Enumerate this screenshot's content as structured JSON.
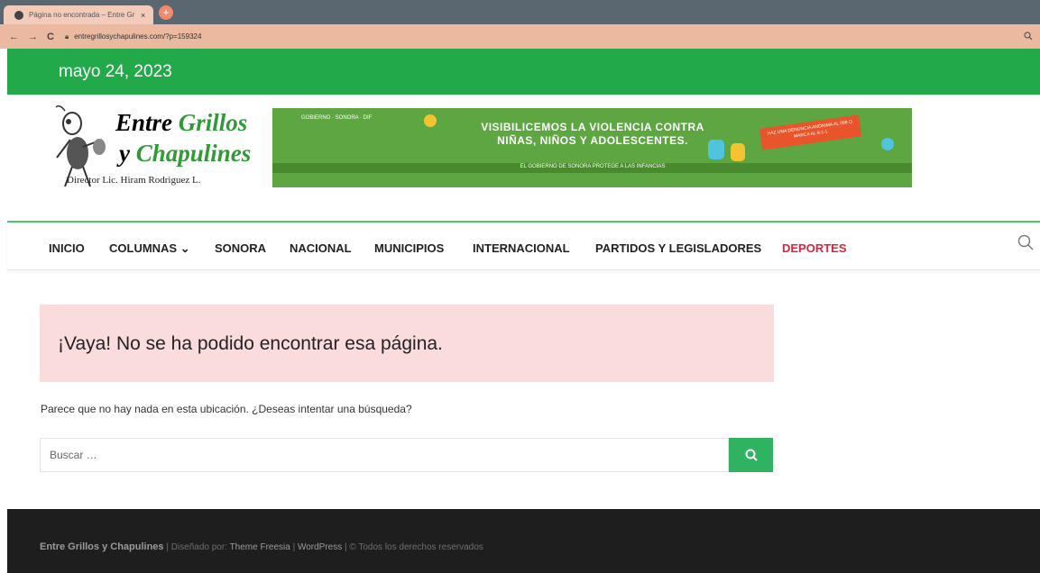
{
  "browser": {
    "tab_title": "Página no encontrada – Entre Gr",
    "tab_close": "×",
    "new_tab": "+",
    "back": "←",
    "forward": "→",
    "reload": "C",
    "url": "entregrillosychapulines.com/?p=159324"
  },
  "site": {
    "date": "mayo 24, 2023",
    "logo": {
      "line1_a": "Entre",
      "line1_b": "Grillos",
      "line2_a": "y",
      "line2_b": "Chapulines",
      "subtitle": "Director Lic. Hiram Rodriguez L."
    },
    "banner": {
      "title": "VISIBILICEMOS LA VIOLENCIA CONTRA NIÑAS, NIÑOS Y ADOLESCENTES.",
      "subtitle": "EL GOBIERNO DE SONORA PROTEGE A LAS INFANCIAS",
      "cta": "HAZ UNA DENUNCIA ANÓNIMA AL 089 O MARCA AL 9-1-1",
      "logos": "GOBIERNO · SONORA · DIF"
    },
    "nav": [
      {
        "label": "INICIO"
      },
      {
        "label": "COLUMNAS ⌄"
      },
      {
        "label": "SONORA"
      },
      {
        "label": "NACIONAL"
      },
      {
        "label": "MUNICIPIOS"
      },
      {
        "label": "INTERNACIONAL"
      },
      {
        "label": "PARTIDOS Y LEGISLADORES"
      },
      {
        "label": "DEPORTES"
      }
    ],
    "accent_color": "#21a94a",
    "highlight_color": "#d7263d"
  },
  "main": {
    "notice": "¡Vaya! No se ha podido encontrar esa página.",
    "info": "Parece que no hay nada en esta ubicación. ¿Deseas intentar una búsqueda?",
    "search_placeholder": "Buscar …"
  },
  "footer": {
    "site_name": "Entre Grillos y Chapulines",
    "sep1": " | Diseñado por: ",
    "theme": "Theme Freesia",
    "sep2": " | ",
    "wp": "WordPress",
    "rights": " | © Todos los derechos reservados"
  }
}
